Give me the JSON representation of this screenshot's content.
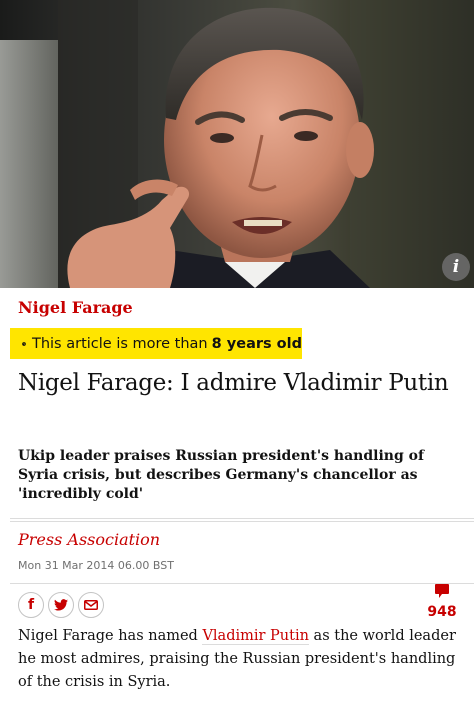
{
  "hero": {
    "alt": "Nigel Farage"
  },
  "info_icon": "i",
  "kicker": "Nigel Farage",
  "age_notice": {
    "prefix": "This article is more than",
    "age": "8 years old"
  },
  "headline": "Nigel Farage: I admire Vladimir Putin",
  "standfirst": "Ukip leader praises Russian president's handling of Syria crisis, but describes Germany's chancellor as 'incredibly cold'",
  "byline": "Press Association",
  "dateline": "Mon 31 Mar 2014 06.00 BST",
  "share": {
    "facebook": "f",
    "twitter": "twitter-bird",
    "email": "envelope"
  },
  "comments": {
    "count": "948"
  },
  "body": {
    "before_link": "Nigel Farage has named ",
    "link": "Vladimir Putin",
    "after_link": " as the world leader he most admires, praising the Russian president's handling of the crisis in Syria."
  },
  "colors": {
    "accent": "#c70000",
    "banner": "#ffe500",
    "text": "#121212",
    "meta": "#707070"
  }
}
